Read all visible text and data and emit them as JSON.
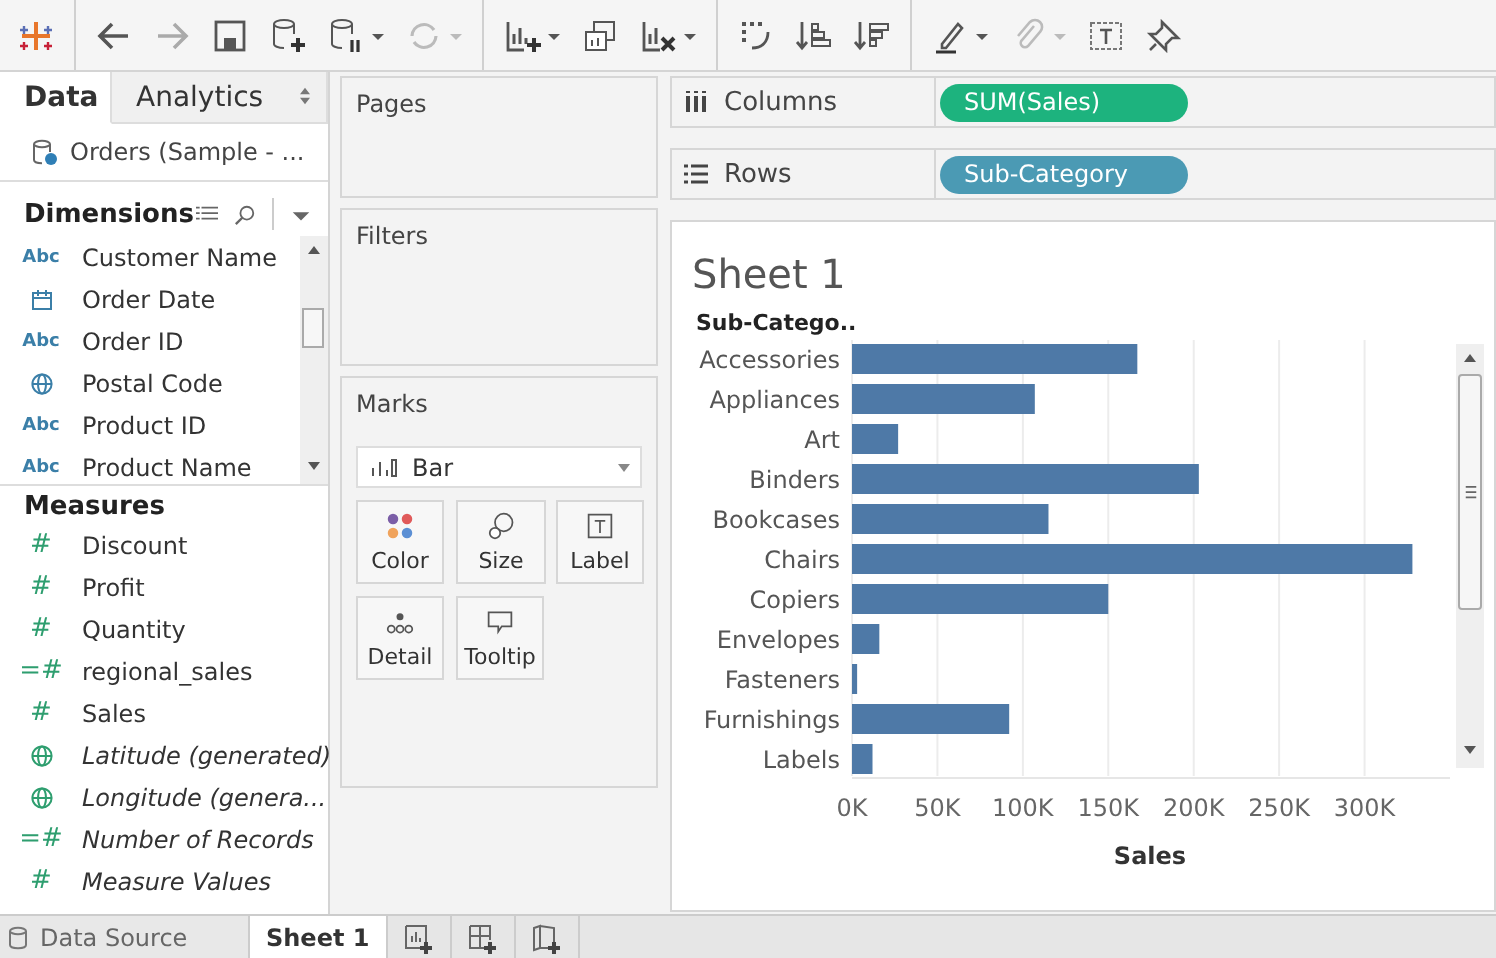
{
  "data_pane": {
    "tabs": [
      {
        "label": "Data",
        "selected": true
      },
      {
        "label": "Analytics",
        "selected": false
      }
    ],
    "data_source": "Orders (Sample - ...",
    "dimensions": {
      "title": "Dimensions",
      "fields": [
        {
          "name": "Customer Name",
          "kind": "text",
          "icon": "Abc",
          "generated": false
        },
        {
          "name": "Order Date",
          "kind": "date",
          "generated": false
        },
        {
          "name": "Order ID",
          "kind": "text",
          "icon": "Abc",
          "generated": false
        },
        {
          "name": "Postal Code",
          "kind": "geo",
          "generated": false
        },
        {
          "name": "Product ID",
          "kind": "text",
          "icon": "Abc",
          "generated": false
        },
        {
          "name": "Product Name",
          "kind": "text",
          "icon": "Abc",
          "generated": false
        }
      ]
    },
    "measures": {
      "title": "Measures",
      "fields": [
        {
          "name": "Discount",
          "kind": "number",
          "icon": "#",
          "generated": false
        },
        {
          "name": "Profit",
          "kind": "number",
          "icon": "#",
          "generated": false
        },
        {
          "name": "Quantity",
          "kind": "number",
          "icon": "#",
          "generated": false
        },
        {
          "name": "regional_sales",
          "kind": "calc",
          "icon": "=#",
          "generated": false
        },
        {
          "name": "Sales",
          "kind": "number",
          "icon": "#",
          "generated": false
        },
        {
          "name": "Latitude (generated)",
          "kind": "geo",
          "generated": true
        },
        {
          "name": "Longitude (genera...",
          "kind": "geo",
          "generated": true
        },
        {
          "name": "Number of Records",
          "kind": "calc",
          "icon": "=#",
          "generated": true
        },
        {
          "name": "Measure Values",
          "kind": "number",
          "icon": "#",
          "generated": true
        }
      ]
    }
  },
  "cards": {
    "pages": "Pages",
    "filters": "Filters",
    "marks": {
      "title": "Marks",
      "mark_type": "Bar",
      "buttons": [
        {
          "label": "Color",
          "kind": "color"
        },
        {
          "label": "Size",
          "kind": "size"
        },
        {
          "label": "Label",
          "kind": "label"
        },
        {
          "label": "Detail",
          "kind": "detail"
        },
        {
          "label": "Tooltip",
          "kind": "tooltip"
        }
      ]
    }
  },
  "shelves": [
    {
      "label": "Columns",
      "kind": "columns",
      "pill": "SUM(Sales)",
      "color": "#1db37e"
    },
    {
      "label": "Rows",
      "kind": "rows",
      "pill": "Sub-Category",
      "color": "#4b9ab4"
    }
  ],
  "sheet": {
    "title": "Sheet 1",
    "chart_data": {
      "type": "bar",
      "orientation": "horizontal",
      "ylabel": "Sub-Catego..",
      "xlabel": "Sales",
      "categories": [
        "Accessories",
        "Appliances",
        "Art",
        "Binders",
        "Bookcases",
        "Chairs",
        "Copiers",
        "Envelopes",
        "Fasteners",
        "Furnishings",
        "Labels"
      ],
      "values": [
        167000,
        107000,
        27000,
        203000,
        115000,
        328000,
        150000,
        16000,
        3000,
        92000,
        12000
      ],
      "xlim": [
        0,
        350000
      ],
      "grid": true,
      "xticks": [
        {
          "value": 0,
          "label": "0K"
        },
        {
          "value": 50000,
          "label": "50K"
        },
        {
          "value": 100000,
          "label": "100K"
        },
        {
          "value": 150000,
          "label": "150K"
        },
        {
          "value": 200000,
          "label": "200K"
        },
        {
          "value": 250000,
          "label": "250K"
        },
        {
          "value": 300000,
          "label": "300K"
        }
      ]
    }
  },
  "bottom_tabs": {
    "data_source": "Data Source",
    "sheets": [
      {
        "label": "Sheet 1",
        "selected": true
      }
    ]
  }
}
